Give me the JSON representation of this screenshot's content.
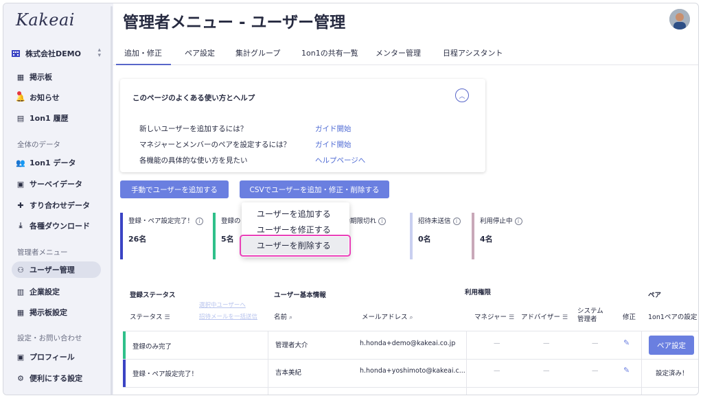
{
  "app": {
    "logo": "Kakeai",
    "page_title": "管理者メニュー - ユーザー管理"
  },
  "sidebar": {
    "org_name": "株式会社DEMO",
    "items_top": [
      {
        "label": "掲示板",
        "icon": "board-icon"
      },
      {
        "label": "お知らせ",
        "icon": "bell-icon"
      },
      {
        "label": "1on1 履歴",
        "icon": "history-icon"
      }
    ],
    "section_data": "全体のデータ",
    "items_data": [
      {
        "label": "1on1 データ",
        "icon": "people-icon"
      },
      {
        "label": "サーベイデータ",
        "icon": "calendar-check-icon"
      },
      {
        "label": "すり合わせデータ",
        "icon": "puzzle-icon"
      },
      {
        "label": "各種ダウンロード",
        "icon": "download-icon"
      }
    ],
    "section_admin": "管理者メニュー",
    "items_admin": [
      {
        "label": "ユーザー管理",
        "icon": "user-gear-icon",
        "active": true
      },
      {
        "label": "企業設定",
        "icon": "building-icon"
      },
      {
        "label": "掲示板設定",
        "icon": "board-settings-icon"
      }
    ],
    "section_settings": "設定・お問い合わせ",
    "items_settings": [
      {
        "label": "プロフィール",
        "icon": "profile-icon"
      },
      {
        "label": "便利にする設定",
        "icon": "gear-icon"
      }
    ]
  },
  "tabs": [
    "追加・修正",
    "ペア設定",
    "集計グループ",
    "1on1の共有一覧",
    "メンター管理",
    "日程アシスタント"
  ],
  "help": {
    "title": "このページのよくある使い方とヘルプ",
    "rows": [
      {
        "q": "新しいユーザーを追加するには？",
        "a": "ガイド開始"
      },
      {
        "q": "マネジャーとメンバーのペアを設定するには？",
        "a": "ガイド開始"
      },
      {
        "q": "各機能の具体的な使い方を見たい",
        "a": "ヘルプページへ"
      }
    ]
  },
  "buttons": {
    "manual_add": "手動でユーザーを追加する",
    "csv": "CSVでユーザーを追加・修正・削除する"
  },
  "dropdown": [
    "ユーザーを追加する",
    "ユーザーを修正する",
    "ユーザーを削除する"
  ],
  "stats": [
    {
      "label": "登録・ペア設定完了！",
      "value": "26名",
      "color": "#3b44c4"
    },
    {
      "label": "登録の",
      "value": "5名",
      "color": "#2fc08a"
    },
    {
      "label": "有効期限切れ",
      "value": "",
      "color": "#e878c8"
    },
    {
      "label": "招待未送信",
      "value": "0名",
      "color": "#c9cff0"
    },
    {
      "label": "利用停止中",
      "value": "4名",
      "color": "#c9a8b8"
    }
  ],
  "table": {
    "group_headers": {
      "status": "登録ステータス",
      "basic": "ユーザー基本情報",
      "rights": "利用権限",
      "pair": "ペア"
    },
    "col_headers": {
      "status": "ステータス",
      "resend": "選択中ユーザーへ",
      "invite": "招待メールを一括送信",
      "name": "名前",
      "email": "メールアドレス",
      "manager": "マネジャー",
      "advisor": "アドバイザー",
      "sysadmin": "システム管理者",
      "edit": "修正",
      "pair_setting": "1on1ペアの設定"
    },
    "rows": [
      {
        "status": "登録のみ完了",
        "name": "管理者大介",
        "email": "h.honda+demo@kakeai.co.jp",
        "pair": "ペア設定",
        "color": "#2fc08a"
      },
      {
        "status": "登録・ペア設定完了！",
        "name": "吉本美紀",
        "email": "h.honda+yoshimoto@kakeai.c...",
        "pair": "設定済み！",
        "color": "#3b44c4"
      }
    ]
  }
}
